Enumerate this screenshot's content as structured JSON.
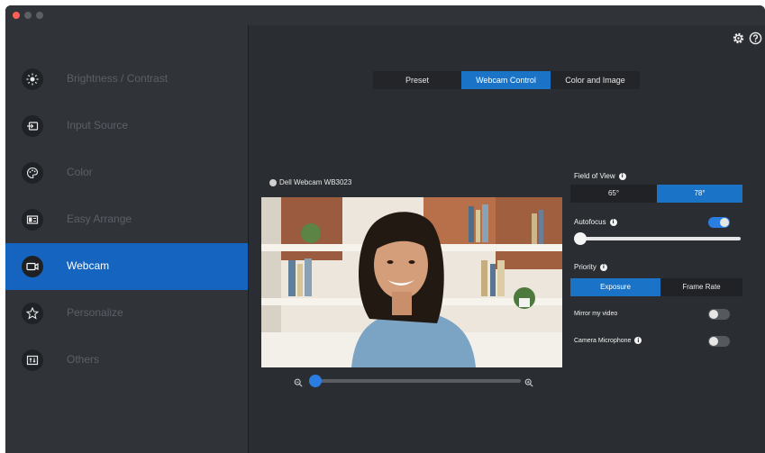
{
  "window": {
    "traffic_lights": [
      "close",
      "minimize",
      "zoom"
    ]
  },
  "sidebar": {
    "items": [
      {
        "label": "Brightness / Contrast",
        "icon": "brightness-icon"
      },
      {
        "label": "Input Source",
        "icon": "input-source-icon"
      },
      {
        "label": "Color",
        "icon": "color-palette-icon"
      },
      {
        "label": "Easy Arrange",
        "icon": "easy-arrange-icon"
      },
      {
        "label": "Webcam",
        "icon": "webcam-icon",
        "active": true
      },
      {
        "label": "Personalize",
        "icon": "star-icon"
      },
      {
        "label": "Others",
        "icon": "others-icon"
      }
    ]
  },
  "header": {
    "settings_icon": "gear-icon",
    "help_icon": "help-icon"
  },
  "tabs": [
    {
      "label": "Preset"
    },
    {
      "label": "Webcam Control",
      "active": true
    },
    {
      "label": "Color and Image"
    }
  ],
  "webcam": {
    "device_name": "Dell Webcam WB3023",
    "zoom_level": 0.0
  },
  "controls": {
    "field_of_view": {
      "title": "Field of View",
      "options": [
        "65°",
        "78°"
      ],
      "selected": "78°"
    },
    "autofocus": {
      "title": "Autofocus",
      "enabled": true,
      "slider_level": 0.0
    },
    "priority": {
      "title": "Priority",
      "options": [
        "Exposure",
        "Frame Rate"
      ],
      "selected": "Exposure"
    },
    "mirror": {
      "title": "Mirror my video",
      "enabled": false
    },
    "microphone": {
      "title": "Camera Microphone",
      "enabled": false
    }
  },
  "colors": {
    "accent": "#1a73c6",
    "sidebar_active": "#1565c0",
    "background": "#2a2d31"
  }
}
